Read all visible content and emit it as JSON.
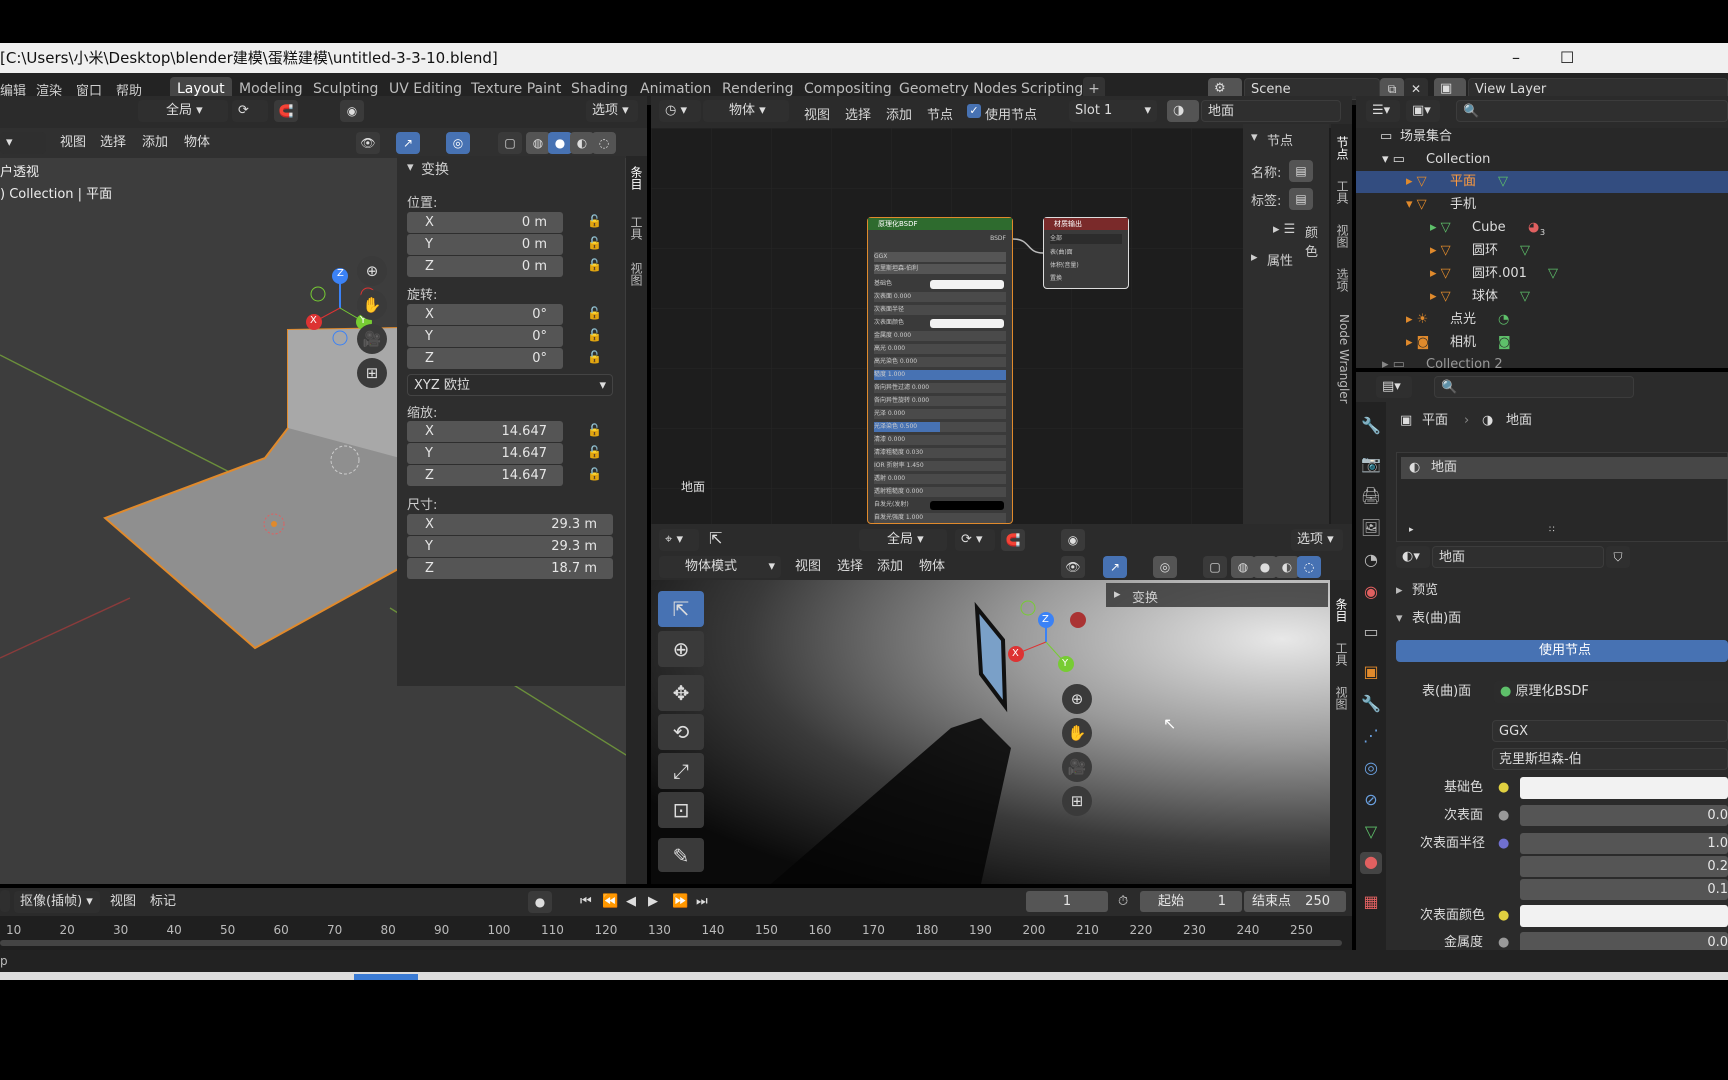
{
  "window": {
    "title": "[C:\\Users\\小米\\Desktop\\blender建模\\蛋糕建模\\untitled-3-3-10.blend]",
    "minimize": "–",
    "maximize": "☐"
  },
  "menu": {
    "items": [
      "编辑",
      "渲染",
      "窗口",
      "帮助"
    ]
  },
  "workspaces": [
    "Layout",
    "Modeling",
    "Sculpting",
    "UV Editing",
    "Texture Paint",
    "Shading",
    "Animation",
    "Rendering",
    "Compositing",
    "Geometry Nodes",
    "Scripting"
  ],
  "workspace_add": "+",
  "scene": {
    "label": "Scene",
    "view_layer": "View Layer"
  },
  "viewport": {
    "orientation": "全局",
    "options": "选项",
    "menus": [
      "视图",
      "选择",
      "添加",
      "物体"
    ],
    "overlay_text1": "户透视",
    "overlay_text2": ") Collection | 平面",
    "gizmo": {
      "x": "X",
      "y": "Y",
      "z": "Z"
    }
  },
  "npanel": {
    "title": "变换",
    "location_label": "位置:",
    "location": [
      {
        "k": "X",
        "v": "0 m"
      },
      {
        "k": "Y",
        "v": "0 m"
      },
      {
        "k": "Z",
        "v": "0 m"
      }
    ],
    "rotation_label": "旋转:",
    "rotation": [
      {
        "k": "X",
        "v": "0°"
      },
      {
        "k": "Y",
        "v": "0°"
      },
      {
        "k": "Z",
        "v": "0°"
      }
    ],
    "rotation_mode": "XYZ 欧拉",
    "scale_label": "缩放:",
    "scale": [
      {
        "k": "X",
        "v": "14.647"
      },
      {
        "k": "Y",
        "v": "14.647"
      },
      {
        "k": "Z",
        "v": "14.647"
      }
    ],
    "dimensions_label": "尺寸:",
    "dimensions": [
      {
        "k": "X",
        "v": "29.3 m"
      },
      {
        "k": "Y",
        "v": "29.3 m"
      },
      {
        "k": "Z",
        "v": "18.7 m"
      }
    ],
    "tabs": [
      "条目",
      "工具",
      "视图"
    ]
  },
  "node_editor": {
    "mode": "物体",
    "menus": [
      "视图",
      "选择",
      "添加",
      "节点"
    ],
    "use_nodes": "使用节点",
    "slot": "Slot 1",
    "material": "地面",
    "side_title": "节点",
    "name_label": "名称:",
    "label_label": "标签:",
    "color_label": "颜色",
    "props_label": "属性",
    "tabs": [
      "节点",
      "工具",
      "视图",
      "选项",
      "Node Wrangler"
    ],
    "canvas_label": "地面",
    "bsdf_title": "原理化BSDF",
    "bsdf_out": "BSDF",
    "bsdf_rows": [
      "GGX",
      "克里斯坦森-伯利",
      "基础色",
      "次表面 0.000",
      "次表面半径",
      "次表面颜色",
      "金属度 0.000",
      "高光 0.000",
      "高光染色 0.000",
      "糙度 1.000",
      "各向异性过滤 0.000",
      "各向异性旋转 0.000",
      "光泽 0.000",
      "光泽染色 0.500",
      "清漆 0.000",
      "清漆粗糙度 0.030",
      "IOR 折射率 1.450",
      "透射 0.000",
      "透射粗糙度 0.000",
      "自发光(发射)",
      "自发光强度 1.000"
    ],
    "out_title": "材质输出",
    "out_rows": [
      "全部",
      "表(曲)面",
      "体积(音量)",
      "置换"
    ]
  },
  "render_view": {
    "orientation": "全局",
    "options": "选项",
    "mode": "物体模式",
    "menus": [
      "视图",
      "选择",
      "添加",
      "物体"
    ],
    "panel": "变换",
    "tabs": [
      "条目",
      "工具",
      "视图"
    ],
    "gizmo": {
      "x": "X",
      "y": "Y",
      "z": "Z"
    }
  },
  "outliner": {
    "title": "场景集合",
    "items": [
      {
        "label": "Collection",
        "depth": 1
      },
      {
        "label": "平面",
        "depth": 2,
        "selected": true
      },
      {
        "label": "手机",
        "depth": 2
      },
      {
        "label": "Cube",
        "depth": 3
      },
      {
        "label": "圆环",
        "depth": 3
      },
      {
        "label": "圆环.001",
        "depth": 3
      },
      {
        "label": "球体",
        "depth": 3
      },
      {
        "label": "点光",
        "depth": 2
      },
      {
        "label": "相机",
        "depth": 2
      },
      {
        "label": "Collection 2",
        "depth": 1
      }
    ],
    "cube_badge": "3"
  },
  "properties": {
    "breadcrumb_obj": "平面",
    "breadcrumb_mat": "地面",
    "slot_name": "地面",
    "material_name": "地面",
    "preview": "预览",
    "surface": "表(曲)面",
    "use_nodes": "使用节点",
    "surface_label": "表(曲)面",
    "surface_value": "原理化BSDF",
    "dist": "GGX",
    "sss": "克里斯坦森-伯",
    "rows": [
      {
        "label": "基础色",
        "value": ""
      },
      {
        "label": "次表面",
        "value": "0.0"
      },
      {
        "label": "次表面半径",
        "value": "1.0"
      },
      {
        "label": "",
        "value": "0.2"
      },
      {
        "label": "",
        "value": "0.1"
      },
      {
        "label": "次表面颜色",
        "value": ""
      },
      {
        "label": "金属度",
        "value": "0.0"
      }
    ]
  },
  "timeline": {
    "mode": "抠像(插帧)",
    "menus": [
      "视图",
      "标记"
    ],
    "current_frame": "1",
    "start_label": "起始",
    "start": "1",
    "end_label": "结束点",
    "end": "250",
    "ticks": [
      "10",
      "20",
      "30",
      "40",
      "50",
      "60",
      "70",
      "80",
      "90",
      "100",
      "110",
      "120",
      "130",
      "140",
      "150",
      "160",
      "170",
      "180",
      "190",
      "200",
      "210",
      "220",
      "230",
      "240",
      "250"
    ]
  },
  "status": {
    "left": "p"
  }
}
